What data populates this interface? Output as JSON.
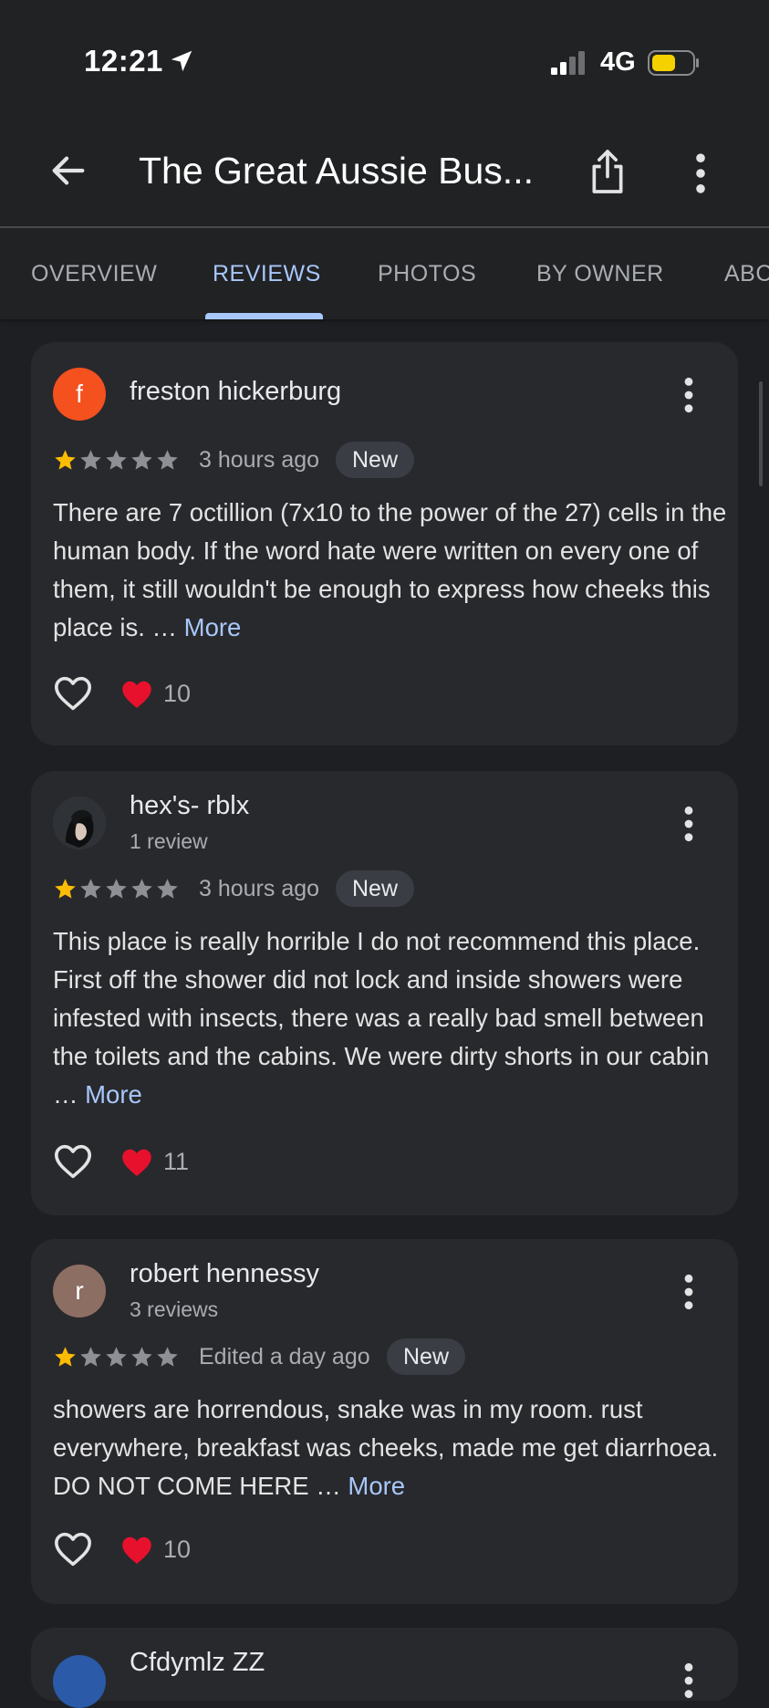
{
  "status_bar": {
    "time": "12:21",
    "network": "4G",
    "battery_color": "#f5d100",
    "location_icon": "location-arrow-icon"
  },
  "header": {
    "title": "The Great Aussie Bus...",
    "back_icon": "back-arrow-icon",
    "share_icon": "share-icon",
    "menu_icon": "more-vert-icon"
  },
  "tabs": [
    {
      "label": "OVERVIEW",
      "active": false
    },
    {
      "label": "REVIEWS",
      "active": true
    },
    {
      "label": "PHOTOS",
      "active": false
    },
    {
      "label": "BY OWNER",
      "active": false
    },
    {
      "label": "ABC",
      "active": false
    }
  ],
  "colors": {
    "accent": "#a8c7fa",
    "star_filled": "#fbbc04",
    "star_empty": "#8e9095",
    "heart": "#e8112d"
  },
  "reviews": [
    {
      "author": "freston hickerburg",
      "avatar_letter": "f",
      "avatar_color": "#f4511e",
      "sub": "",
      "rating": 1,
      "when": "3 hours ago",
      "badge": "New",
      "text": "There are 7 octillion (7x10 to the power of the 27) cells in the human body. If the word hate were written on every one of them, it still wouldn't be enough to express how cheeks this place is. … ",
      "more": "More",
      "likes": "10"
    },
    {
      "author": "hex's- rblx",
      "avatar_letter": "",
      "avatar_color": "#3a3f44",
      "sub": "1 review",
      "rating": 1,
      "when": "3 hours ago",
      "badge": "New",
      "text": "This place is really horrible I do not recommend this place. First off the shower did not lock and inside showers were infested with insects, there was a really bad smell between the toilets and the cabins. We were dirty shorts in our cabin … ",
      "more": "More",
      "likes": "11"
    },
    {
      "author": "robert hennessy",
      "avatar_letter": "r",
      "avatar_color": "#8d6e63",
      "sub": "3 reviews",
      "rating": 1,
      "when": "Edited a day ago",
      "badge": "New",
      "text": "showers are horrendous, snake was in my room. rust everywhere, breakfast was cheeks, made me get diarrhoea. DO NOT COME HERE … ",
      "more": "More",
      "likes": "10"
    },
    {
      "author": "Cfdymlz ZZ",
      "avatar_letter": "",
      "avatar_color": "#2a5aa8"
    }
  ]
}
